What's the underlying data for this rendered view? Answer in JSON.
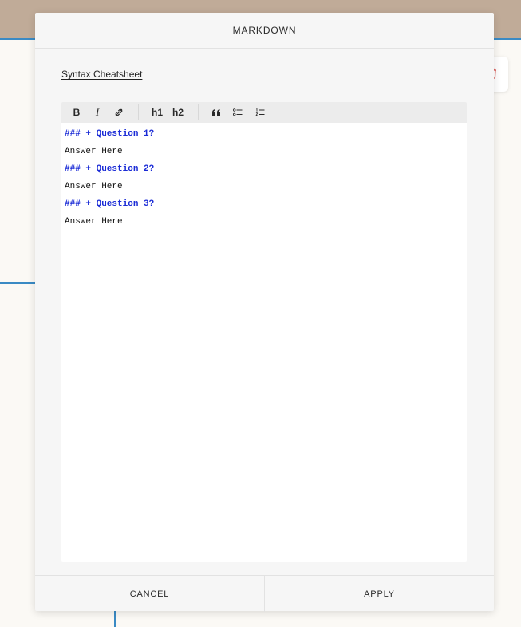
{
  "modal": {
    "title": "MARKDOWN",
    "cheatsheet_link": "Syntax Cheatsheet",
    "toolbar": {
      "bold_label": "B",
      "italic_label": "I",
      "h1_label": "h1",
      "h2_label": "h2"
    },
    "editor": {
      "lines": [
        {
          "text": "### + Question 1?",
          "kind": "heading"
        },
        {
          "text": "Answer Here",
          "kind": "text"
        },
        {
          "text": "### + Question 2?",
          "kind": "heading"
        },
        {
          "text": "Answer Here",
          "kind": "text"
        },
        {
          "text": "### + Question 3?",
          "kind": "heading"
        },
        {
          "text": "Answer Here",
          "kind": "text"
        }
      ]
    },
    "footer": {
      "cancel_label": "CANCEL",
      "apply_label": "APPLY"
    }
  },
  "colors": {
    "heading_text": "#1a2bd6",
    "accent_line": "#3a8ac4",
    "header_band": "#c0ab98",
    "delete_icon": "#d9534f"
  },
  "icons": {
    "background_card": "trash-icon",
    "toolbar": [
      "bold-icon",
      "italic-icon",
      "link-icon",
      "h1-icon",
      "h2-icon",
      "quote-icon",
      "bullet-list-icon",
      "numbered-list-icon"
    ]
  }
}
